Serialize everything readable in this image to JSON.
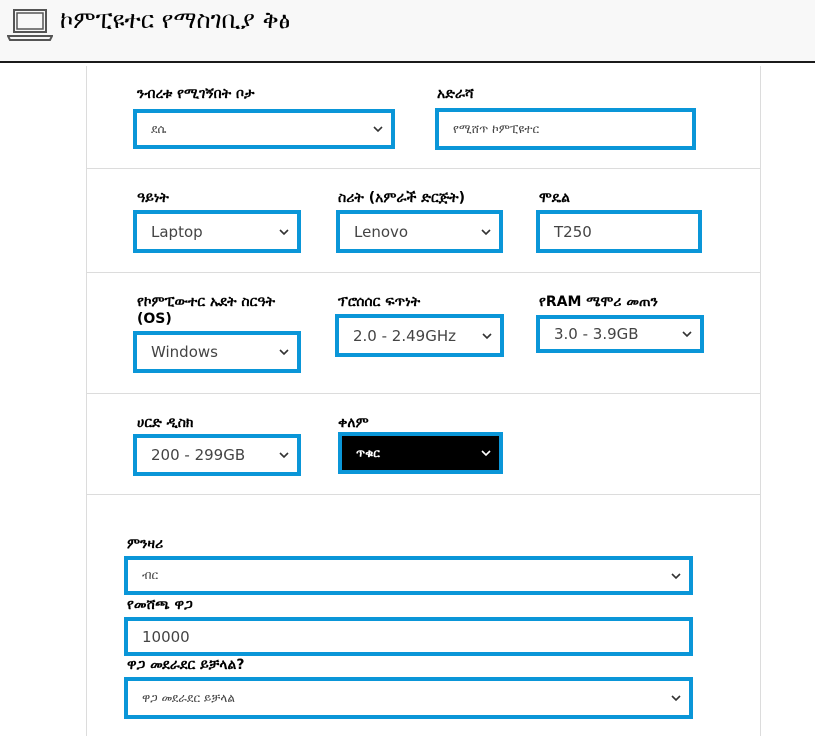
{
  "header": {
    "title": "ኮምፒዩተር የማስገቢያ ቅፅ",
    "icon": "laptop-icon"
  },
  "form": {
    "location": {
      "label": "ንብረቱ የሚገኝበት ቦታ",
      "value": "ደሴ"
    },
    "address": {
      "label": "አድራሻ",
      "placeholder": "የሚሸጥ ኮምፒዩተር"
    },
    "type": {
      "label": "ዓይነት",
      "value": "Laptop"
    },
    "brand": {
      "label": "ስሪት (አምራች ድርጅት)",
      "value": "Lenovo"
    },
    "model": {
      "label": "ሞዴል",
      "value": "T250"
    },
    "os": {
      "label_line1": "የኮምፒውተር ኡደት ስርዓት",
      "label_line2": "(OS)",
      "value": "Windows"
    },
    "processor": {
      "label": "ፕሮሰሰር ፍጥነት",
      "value": "2.0 - 2.49GHz"
    },
    "ram": {
      "label": "የRAM ሜሞሪ መጠን",
      "value": "3.0 - 3.9GB"
    },
    "hdd": {
      "label": "ሀርድ ዲስክ",
      "value": "200 - 299GB"
    },
    "color": {
      "label": "ቀለም",
      "value": "ጥቁር"
    },
    "currency": {
      "label": "ምንዛሪ",
      "value": "ብር"
    },
    "price": {
      "label": "የመሸጫ ዋጋ",
      "value": "10000"
    },
    "negotiable": {
      "label": "ዋጋ መደራደር ይቻላል?",
      "value": "ዋጋ መደራደር ይቻላል"
    }
  },
  "colors": {
    "field_border": "#0a96d8",
    "header_bg": "#f8f8f8"
  }
}
